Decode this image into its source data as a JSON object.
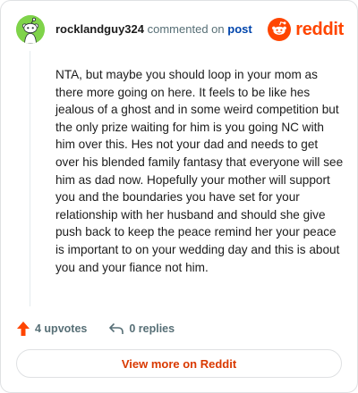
{
  "comment": {
    "username": "rocklandguy324",
    "action_text": "commented on",
    "post_link": "post",
    "body": "NTA, but maybe you should loop in your mom as there more going on here. It feels to be like hes jealous of a ghost and in some weird competition but the only prize waiting for him is you going NC with him over this. Hes not your dad and needs to get over his blended family fantasy that everyone will see him as dad now. Hopefully your mother will support you and the boundaries you have set for your relationship with her husband and should she give push back to keep the peace remind her your peace is important to on your wedding day and this is about you and your fiance not him."
  },
  "brand": {
    "name": "reddit",
    "icon": "reddit-logo-icon",
    "color": "#ff4500"
  },
  "avatar": {
    "icon": "snoo-avatar-icon",
    "color": "#7fd34a"
  },
  "actions": {
    "upvotes_label": "4 upvotes",
    "replies_label": "0 replies",
    "upvote_icon": "upvote-arrow-icon",
    "reply_icon": "reply-arrow-icon",
    "upvote_color": "#ff4500"
  },
  "footer": {
    "view_more_label": "View more on Reddit",
    "view_more_color": "#d93900"
  },
  "colors": {
    "link": "#0045ac",
    "muted": "#576f76",
    "border": "#dfe1e3"
  }
}
